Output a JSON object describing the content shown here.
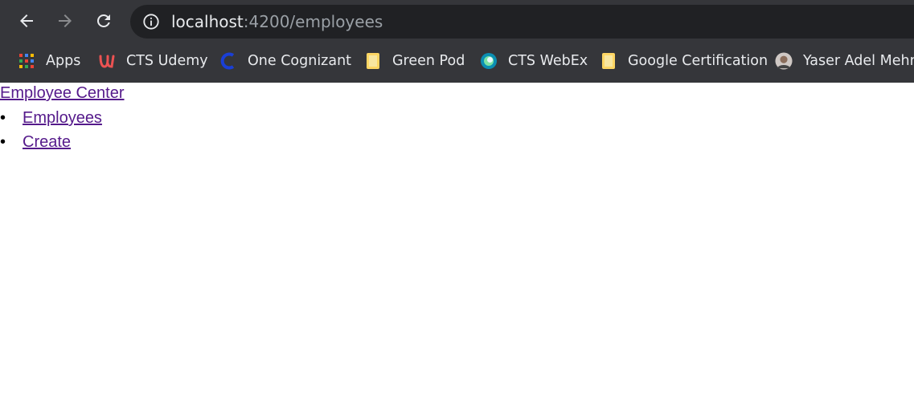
{
  "browser": {
    "url_host": "localhost",
    "url_path": ":4200/employees",
    "bookmarks": [
      {
        "label": "Apps",
        "icon": "apps-grid-icon"
      },
      {
        "label": "CTS Udemy",
        "icon": "udemy-icon"
      },
      {
        "label": "One Cognizant",
        "icon": "cognizant-icon"
      },
      {
        "label": "Green Pod",
        "icon": "folder-icon"
      },
      {
        "label": "CTS WebEx",
        "icon": "webex-icon"
      },
      {
        "label": "Google Certification",
        "icon": "folder-icon"
      },
      {
        "label": "Yaser Adel Mehra",
        "icon": "avatar-icon"
      }
    ]
  },
  "page": {
    "brand_link": "Employee Center",
    "nav": [
      {
        "label": "Employees"
      },
      {
        "label": "Create"
      }
    ]
  },
  "colors": {
    "chrome_bg": "#35363a",
    "omnibox_bg": "#202124",
    "visited_link": "#551a8b"
  }
}
